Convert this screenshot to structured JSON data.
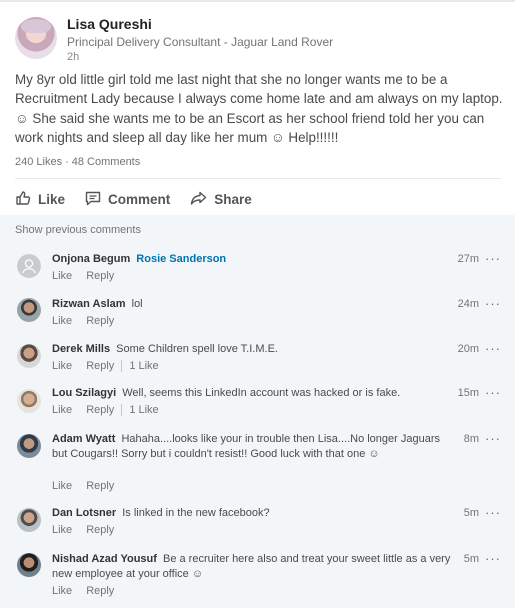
{
  "post": {
    "author": "Lisa Qureshi",
    "title": "Principal Delivery Consultant - Jaguar Land Rover",
    "time": "2h",
    "body": [
      "My 8yr old little girl told me last night that she no longer wants me to be a",
      "Recruitment Lady because I always come home late and am always on my laptop.",
      "☺︎   She said she wants me to be an Escort as her school friend told her you can",
      "work nights and sleep all day like her mum ☺︎  Help!!!!!!"
    ],
    "likes": "240 Likes",
    "comments_count": "48 Comments",
    "actions": {
      "like": "Like",
      "comment": "Comment",
      "share": "Share"
    }
  },
  "comments_section": {
    "show_previous": "Show previous comments",
    "like_label": "Like",
    "reply_label": "Reply",
    "more": "···",
    "items": [
      {
        "name": "Onjona Begum",
        "mention": "Rosie Sanderson",
        "text": "",
        "time": "27m",
        "likes": ""
      },
      {
        "name": "Rizwan Aslam",
        "mention": "",
        "text": "lol",
        "time": "24m",
        "likes": ""
      },
      {
        "name": "Derek Mills",
        "mention": "",
        "text": "Some Children spell love T.I.M.E.",
        "time": "20m",
        "likes": "1 Like"
      },
      {
        "name": "Lou Szilagyi",
        "mention": "",
        "text": "Well, seems this LinkedIn account was hacked or is fake.",
        "time": "15m",
        "likes": "1 Like"
      },
      {
        "name": "Adam Wyatt",
        "mention": "",
        "text": "Hahaha....looks like your in trouble then Lisa....No longer Jaguars but Cougars!! Sorry but i couldn't resist!! Good luck with that one ☺︎",
        "time": "8m",
        "likes": ""
      },
      {
        "name": "Dan Lotsner",
        "mention": "",
        "text": "Is linked in the new facebook?",
        "time": "5m",
        "likes": ""
      },
      {
        "name": "Nishad Azad Yousuf",
        "mention": "",
        "text": "Be a recruiter here also and treat your sweet little as a very new employee at your office ☺︎",
        "time": "5m",
        "likes": ""
      }
    ]
  }
}
